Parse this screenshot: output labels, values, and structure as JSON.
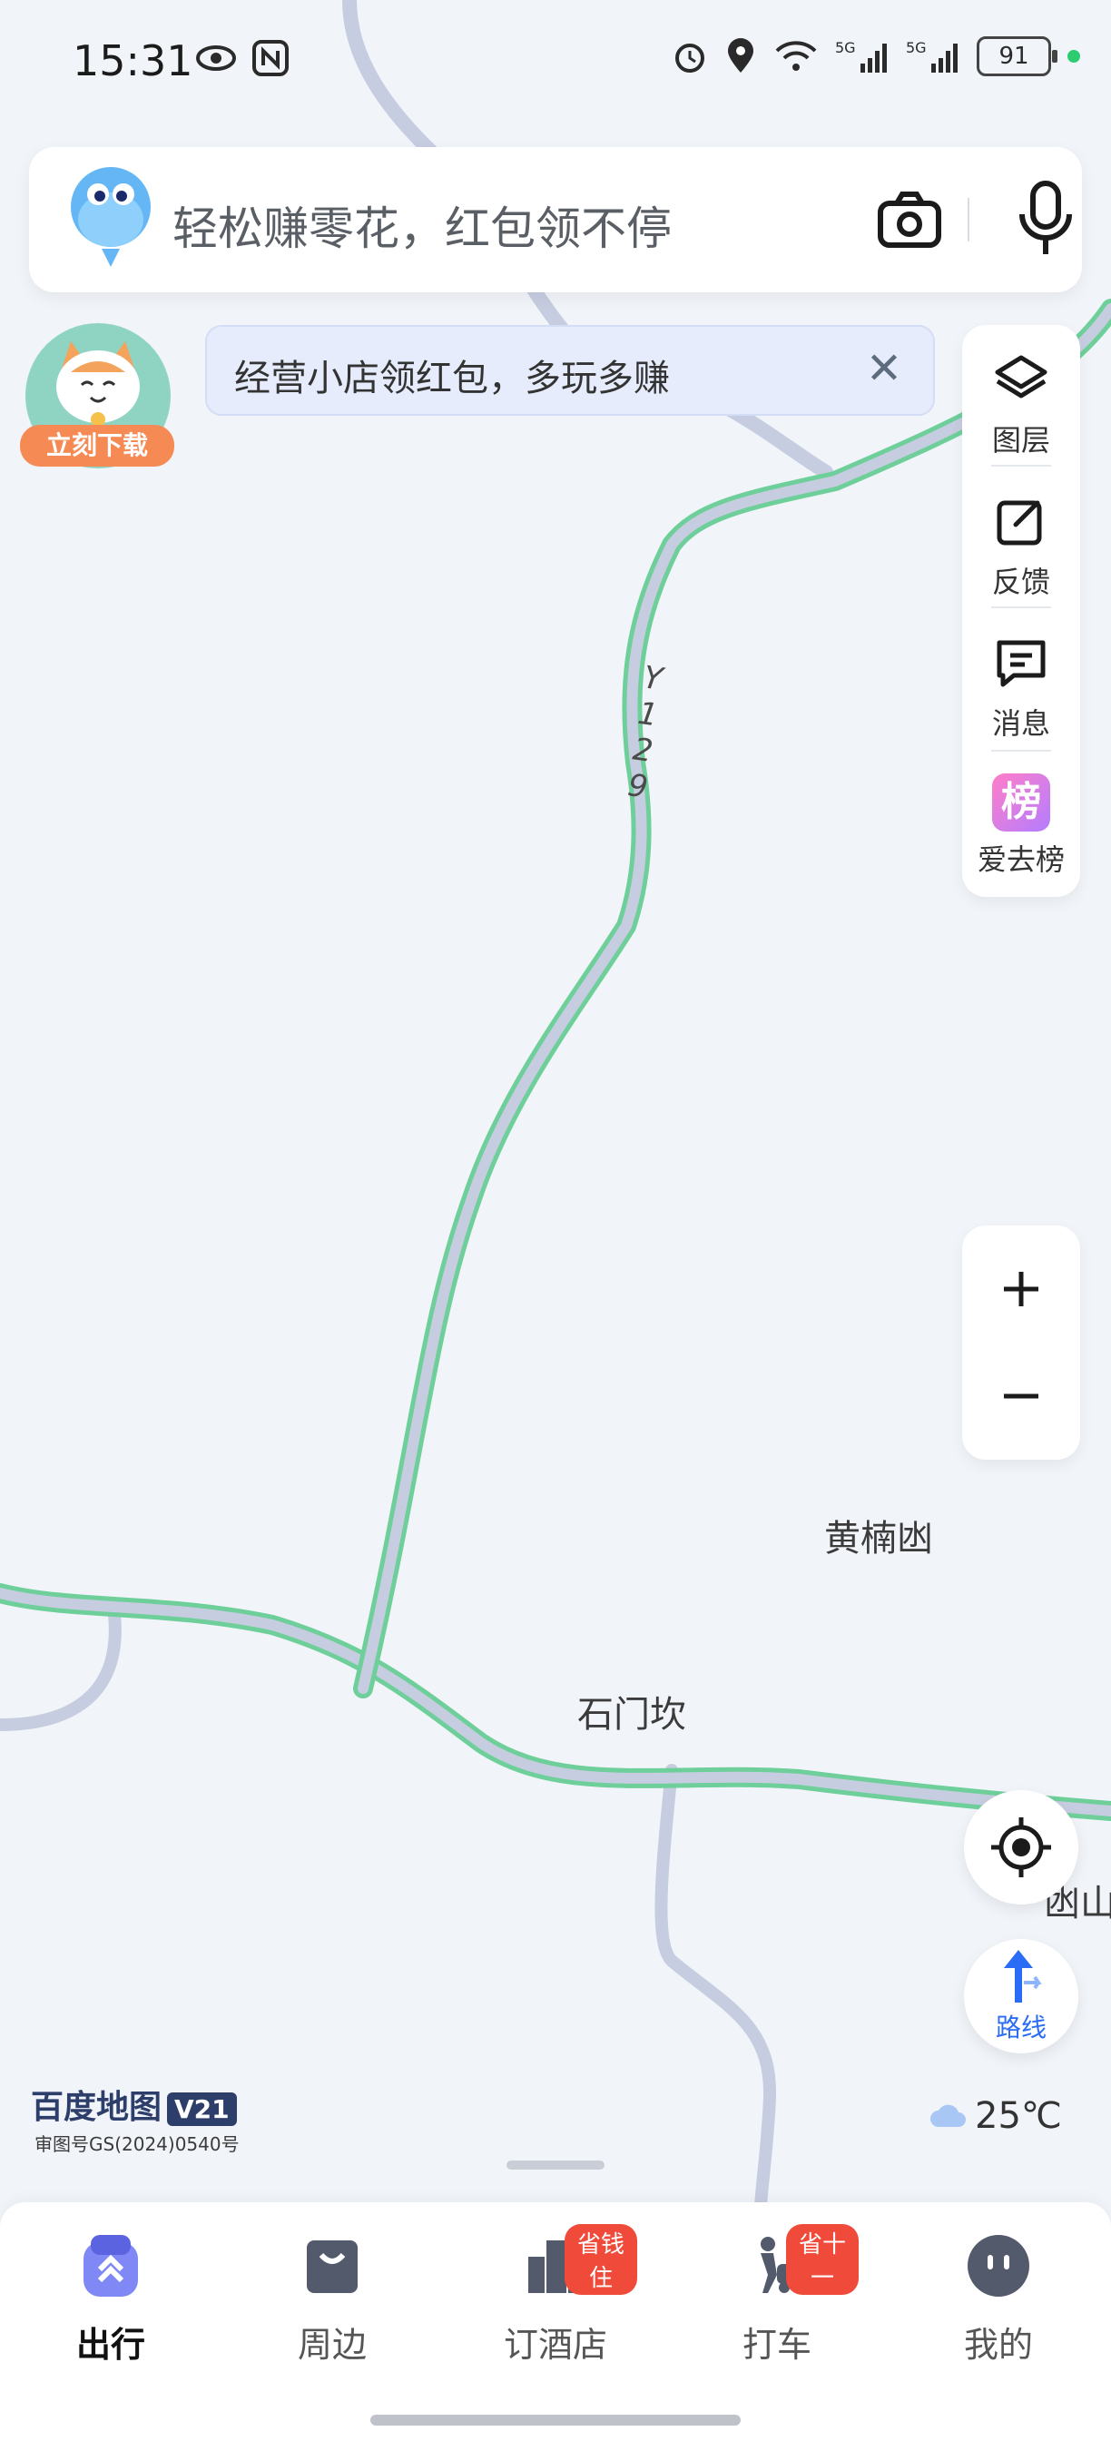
{
  "status": {
    "time": "15:31",
    "battery": "91"
  },
  "search": {
    "placeholder_text": "轻松赚零花，红包领不停"
  },
  "promo": {
    "label": "立刻下载"
  },
  "banner": {
    "text": "经营小店领红包，多玩多赚"
  },
  "tools": [
    {
      "label": "图层",
      "icon": "layers-icon"
    },
    {
      "label": "反馈",
      "icon": "feedback-icon"
    },
    {
      "label": "消息",
      "icon": "message-icon"
    },
    {
      "label": "爱去榜",
      "icon": "ranking-icon"
    }
  ],
  "map": {
    "labels": {
      "road": "Y129",
      "place1": "黄楠凼",
      "place2": "石门坎",
      "partial": "凼山"
    },
    "colors": {
      "road_green": "#6fcf9a",
      "road_gray": "#c7cde0"
    }
  },
  "brand": {
    "logo": "百度地图",
    "version": "V21",
    "approval": "审图号GS(2024)0540号"
  },
  "weather": {
    "temp": "25℃",
    "icon": "cloud-icon"
  },
  "route": {
    "label": "路线"
  },
  "nav": [
    {
      "label": "出行",
      "active": true
    },
    {
      "label": "周边"
    },
    {
      "label": "订酒店",
      "badge": "省钱住"
    },
    {
      "label": "打车",
      "badge": "省十一"
    },
    {
      "label": "我的"
    }
  ]
}
